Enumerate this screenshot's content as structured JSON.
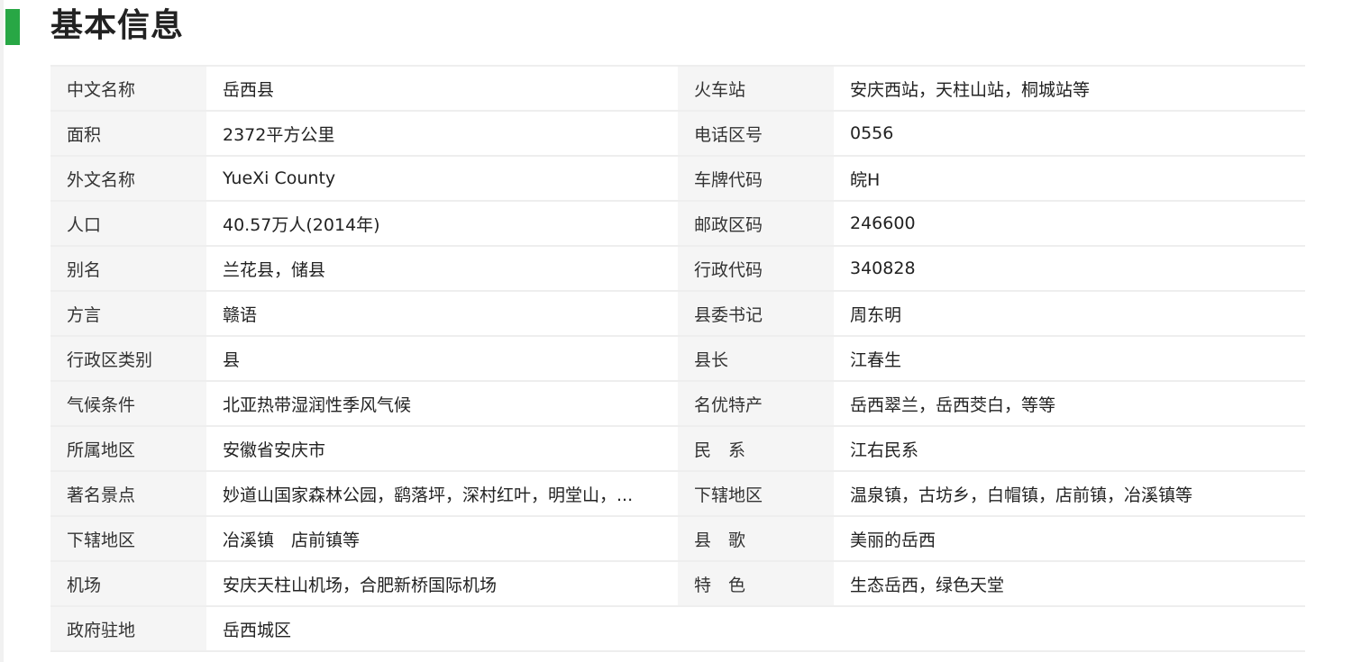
{
  "section": {
    "title": "基本信息",
    "accent_color": "#28a745"
  },
  "rows": [
    {
      "label1": "中文名称",
      "value1": "岳西县",
      "label2": "火车站",
      "value2": "安庆西站，天柱山站，桐城站等"
    },
    {
      "label1": "面积",
      "value1": "2372平方公里",
      "label2": "电话区号",
      "value2": "0556"
    },
    {
      "label1": "外文名称",
      "value1": "YueXi County",
      "label2": "车牌代码",
      "value2": "皖H"
    },
    {
      "label1": "人口",
      "value1": "40.57万人(2014年)",
      "label2": "邮政区码",
      "value2": "246600"
    },
    {
      "label1": "别名",
      "value1": "兰花县，储县",
      "label2": "行政代码",
      "value2": "340828"
    },
    {
      "label1": "方言",
      "value1": "赣语",
      "label2": "县委书记",
      "value2": "周东明"
    },
    {
      "label1": "行政区类别",
      "value1": "县",
      "label2": "县长",
      "value2": "江春生"
    },
    {
      "label1": "气候条件",
      "value1": "北亚热带湿润性季风气候",
      "label2": "名优特产",
      "value2": "岳西翠兰，岳西茭白，等等"
    },
    {
      "label1": "所属地区",
      "value1": "安徽省安庆市",
      "label2": "民　系",
      "value2": "江右民系"
    },
    {
      "label1": "著名景点",
      "value1": "妙道山国家森林公园，鹞落坪，深村红叶，明堂山，...",
      "label2": "下辖地区",
      "value2": "温泉镇，古坊乡，白帽镇，店前镇，冶溪镇等"
    },
    {
      "label1": "下辖地区",
      "value1": "冶溪镇　店前镇等",
      "label2": "县　歌",
      "value2": "美丽的岳西"
    },
    {
      "label1": "机场",
      "value1": "安庆天柱山机场，合肥新桥国际机场",
      "label2": "特　色",
      "value2": "生态岳西，绿色天堂"
    },
    {
      "label1": "政府驻地",
      "value1": "岳西城区"
    }
  ]
}
